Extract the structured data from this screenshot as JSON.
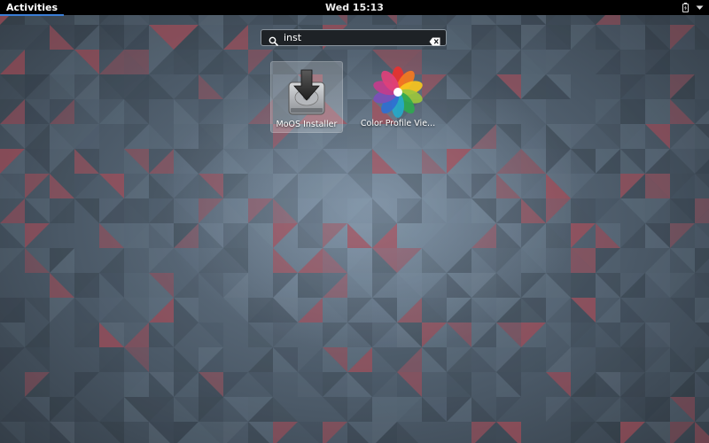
{
  "top_bar": {
    "activities_label": "Activities",
    "clock": "Wed 15:13",
    "battery_icon": "battery-charging-icon",
    "menu_icon": "chevron-down-icon"
  },
  "search": {
    "value": "inst",
    "icon": "search-icon",
    "clear_icon": "backspace-clear-icon"
  },
  "results": [
    {
      "label": "MoOS Installer",
      "icon": "disk-installer-icon",
      "selected": true
    },
    {
      "label": "Color Profile Vie...",
      "icon": "color-profile-flower-icon",
      "selected": false
    }
  ],
  "colors": {
    "top_bar_bg": "#000000",
    "activities_underline": "#3a7dd6",
    "wallpaper_base": "#4a5866"
  }
}
